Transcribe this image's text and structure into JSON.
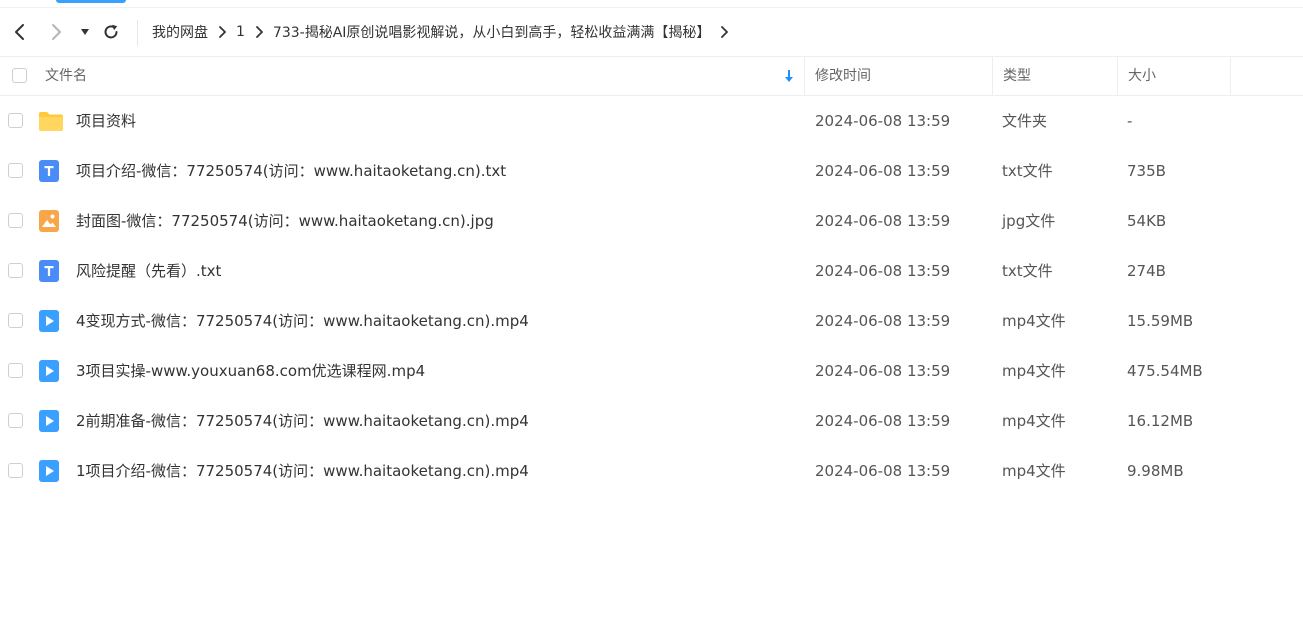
{
  "nav": {
    "breadcrumb": [
      "我的网盘",
      "1",
      "733-揭秘AI原创说唱影视解说，从小白到高手，轻松收益满满【揭秘】"
    ]
  },
  "table": {
    "headers": {
      "name": "文件名",
      "modified": "修改时间",
      "type": "类型",
      "size": "大小"
    },
    "rows": [
      {
        "name": "项目资料",
        "modified": "2024-06-08 13:59",
        "type": "文件夹",
        "size": "-",
        "icon": "folder-icon"
      },
      {
        "name": "项目介绍-微信：77250574(访问：www.haitaoketang.cn).txt",
        "modified": "2024-06-08 13:59",
        "type": "txt文件",
        "size": "735B",
        "icon": "txt-file-icon"
      },
      {
        "name": "封面图-微信：77250574(访问：www.haitaoketang.cn).jpg",
        "modified": "2024-06-08 13:59",
        "type": "jpg文件",
        "size": "54KB",
        "icon": "image-file-icon"
      },
      {
        "name": "风险提醒（先看）.txt",
        "modified": "2024-06-08 13:59",
        "type": "txt文件",
        "size": "274B",
        "icon": "txt-file-icon"
      },
      {
        "name": "4变现方式-微信：77250574(访问：www.haitaoketang.cn).mp4",
        "modified": "2024-06-08 13:59",
        "type": "mp4文件",
        "size": "15.59MB",
        "icon": "video-file-icon"
      },
      {
        "name": "3项目实操-www.youxuan68.com优选课程网.mp4",
        "modified": "2024-06-08 13:59",
        "type": "mp4文件",
        "size": "475.54MB",
        "icon": "video-file-icon"
      },
      {
        "name": "2前期准备-微信：77250574(访问：www.haitaoketang.cn).mp4",
        "modified": "2024-06-08 13:59",
        "type": "mp4文件",
        "size": "16.12MB",
        "icon": "video-file-icon"
      },
      {
        "name": "1项目介绍-微信：77250574(访问：www.haitaoketang.cn).mp4",
        "modified": "2024-06-08 13:59",
        "type": "mp4文件",
        "size": "9.98MB",
        "icon": "video-file-icon"
      }
    ]
  },
  "colors": {
    "accent": "#3aa0ff",
    "folder": "#ffc83d",
    "txt": "#4a8cf7",
    "image": "#f7a64a",
    "video": "#3aa0ff"
  }
}
